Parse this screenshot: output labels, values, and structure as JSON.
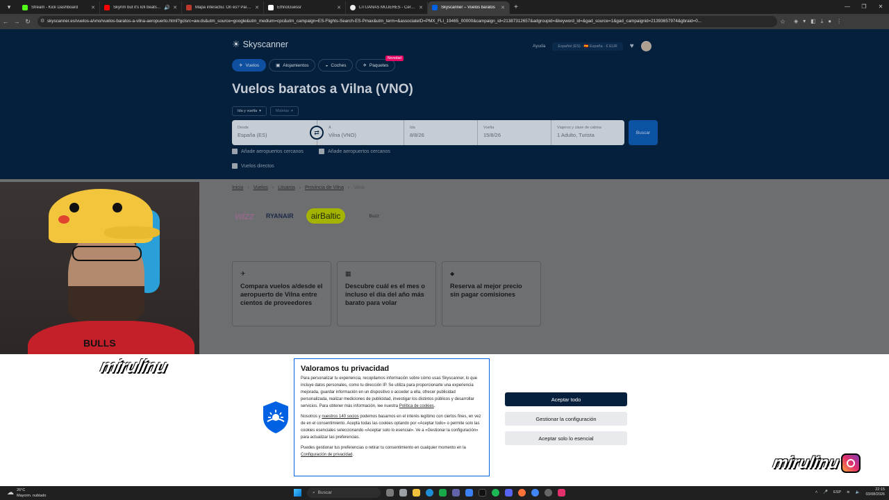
{
  "browser": {
    "tabs": [
      {
        "title": "Stream - Kick Dashboard",
        "color": "#53fc18",
        "active": false
      },
      {
        "title": "Skyrim but it's lofi beats | R",
        "color": "#ff0000",
        "active": false
      },
      {
        "title": "Mapa interactiu: On és? Països",
        "color": "#c0392b",
        "active": false
      },
      {
        "title": "EthnoGuessr",
        "color": "#ffffff",
        "active": false
      },
      {
        "title": "LITUANAS MUJERES - Cerca de",
        "color": "#eeeeee",
        "active": false
      },
      {
        "title": "Skyscanner – Vuelos baratos",
        "color": "#0062e3",
        "active": true
      }
    ],
    "new_tab": "+",
    "url": "skyscanner.es/vuelos-a/vno/vuelos-baratos-a-vilna-aeropuerto.html?gclsrc=aw.ds&utm_source=google&utm_medium=cpc&utm_campaign=ES-Flights-Search-ES-Pmax&utm_term=&associateID=PMX_FLI_19465_00000&campaign_id=21387312657&adgroupid=&keyword_id=&gad_source=1&gad_campaignid=21393657974&gbraid=0..."
  },
  "site": {
    "logo": "Skyscanner",
    "help": "Ayuda",
    "locale": "Español (ES) · 🇪🇸 España · € EUR",
    "services": [
      {
        "label": "Vuelos",
        "icon": "✈",
        "active": true
      },
      {
        "label": "Alojamientos",
        "icon": "▣",
        "active": false
      },
      {
        "label": "Coches",
        "icon": "◒",
        "active": false
      },
      {
        "label": "Paquetes",
        "icon": "✈",
        "active": false
      }
    ],
    "new_badge": "Novedad",
    "title": "Vuelos baratos a Vilna (VNO)",
    "trip_type": "Ida y vuelta",
    "luggage": "Maletas",
    "search": {
      "from_label": "Desde",
      "from_value": "España (ES)",
      "to_label": "A",
      "to_value": "Vilna (VNO)",
      "depart_label": "Ida",
      "depart_value": "8/8/26",
      "return_label": "Vuelta",
      "return_value": "15/8/26",
      "pax_label": "Viajeros y clase de cabina",
      "pax_value": "1 Adulto, Turista",
      "button": "Buscar"
    },
    "checkboxes": {
      "nearby_from": "Añade aeropuertos cercanos",
      "nearby_to": "Añade aeropuertos cercanos",
      "direct": "Vuelos directos"
    },
    "breadcrumb": [
      "Inicio",
      "Vuelos",
      "Lituania",
      "Provincia de Vilna",
      "Vilna"
    ],
    "airlines": [
      "wizz",
      "RYANAIR",
      "airBaltic",
      "Buzz"
    ],
    "cards": [
      {
        "icon": "✈",
        "text": "Compara vuelos a/desde el aeropuerto de Vilna entre cientos de proveedores"
      },
      {
        "icon": "▦",
        "text": "Descubre cuál es el mes o incluso el día del año más barato para volar"
      },
      {
        "icon": "⬥",
        "text": "Reserva al mejor precio sin pagar comisiones"
      }
    ]
  },
  "stream": {
    "watermark": "mirulinu",
    "watermark2": "mirulinu",
    "shirt_text": "BULLS"
  },
  "cookie": {
    "title": "Valoramos tu privacidad",
    "p1": "Para personalizar tu experiencia, recopilamos información sobre cómo usas Skyscanner, lo que incluye datos personales, como tu dirección IP. Se utiliza para proporcionarte una experiencia mejorada, guardar información en un dispositivo o acceder a ella, ofrecer publicidad personalizada, realizar mediciones de publicidad, investigar los distintos públicos y desarrollar servicios. Para obtener más información, lee nuestra",
    "p1_link": "Política de cookies",
    "p2_a": "Nosotros y",
    "p2_link": "nuestros 140 socios",
    "p2_b": "podemos basarnos en el interés legítimo con ciertos fines, en vez de en el consentimiento. Acepta todas las cookies optando por «Aceptar todo» o permite solo las cookies esenciales seleccionando «Aceptar solo lo esencial». Ve a «Gestionar la configuración» para actualizar las preferencias.",
    "p3": "Puedes gestionar tus preferencias o retirar tu consentimiento en cualquier momento en la",
    "p3_link": "Configuración de privacidad",
    "accept_all": "Aceptar todo",
    "manage": "Gestionar la configuración",
    "essential": "Aceptar solo lo esencial"
  },
  "taskbar": {
    "temp": "26°C",
    "weather": "Mayorm. nublado",
    "search": "Buscar",
    "lang": "ESP",
    "time": "22:15",
    "date": "03/08/2026"
  }
}
